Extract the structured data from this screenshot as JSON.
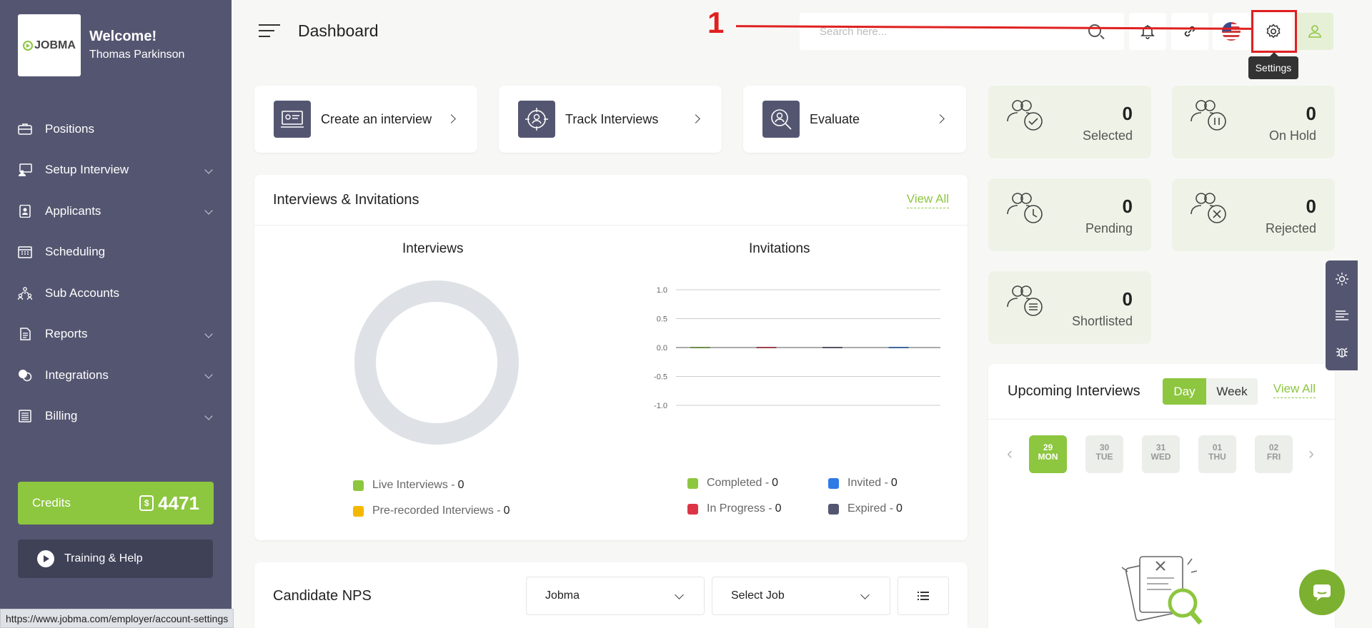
{
  "sidebar": {
    "logo_text": "JOBMA",
    "welcome": "Welcome!",
    "username": "Thomas Parkinson",
    "items": [
      {
        "label": "Positions"
      },
      {
        "label": "Setup Interview"
      },
      {
        "label": "Applicants"
      },
      {
        "label": "Scheduling"
      },
      {
        "label": "Sub Accounts"
      },
      {
        "label": "Reports"
      },
      {
        "label": "Integrations"
      },
      {
        "label": "Billing"
      }
    ],
    "credits_label": "Credits",
    "credits_value": "4471",
    "training_label": "Training & Help"
  },
  "header": {
    "title": "Dashboard",
    "search_placeholder": "Search here...",
    "tooltip": "Settings"
  },
  "annotation": {
    "number": "1"
  },
  "quick_actions": [
    {
      "label": "Create an interview"
    },
    {
      "label": "Track Interviews"
    },
    {
      "label": "Evaluate"
    }
  ],
  "stats": [
    {
      "value": "0",
      "label": "Selected"
    },
    {
      "value": "0",
      "label": "On Hold"
    },
    {
      "value": "0",
      "label": "Pending"
    },
    {
      "value": "0",
      "label": "Rejected"
    },
    {
      "value": "0",
      "label": "Shortlisted"
    }
  ],
  "interviews_panel": {
    "title": "Interviews & Invitations",
    "view_all": "View All",
    "interviews_title": "Interviews",
    "invitations_title": "Invitations",
    "interview_legend": [
      {
        "label": "Live Interviews - ",
        "value": "0",
        "color": "#8dc63f"
      },
      {
        "label": "Pre-recorded Interviews - ",
        "value": "0",
        "color": "#f5b800"
      }
    ],
    "invitation_legend": [
      {
        "label": "Completed - ",
        "value": "0",
        "color": "#8dc63f"
      },
      {
        "label": "Invited - ",
        "value": "0",
        "color": "#2f7ae5"
      },
      {
        "label": "In Progress - ",
        "value": "0",
        "color": "#dc3545"
      },
      {
        "label": "Expired - ",
        "value": "0",
        "color": "#545671"
      }
    ]
  },
  "chart_data": [
    {
      "type": "pie",
      "title": "Interviews",
      "categories": [
        "Live Interviews",
        "Pre-recorded Interviews"
      ],
      "values": [
        0,
        0
      ]
    },
    {
      "type": "line",
      "title": "Invitations",
      "ylim": [
        -1.0,
        1.0
      ],
      "yticks": [
        "1.0",
        "0.5",
        "0.0",
        "-0.5",
        "-1.0"
      ],
      "series": [
        {
          "name": "Completed",
          "values": [
            0
          ]
        },
        {
          "name": "Invited",
          "values": [
            0
          ]
        },
        {
          "name": "In Progress",
          "values": [
            0
          ]
        },
        {
          "name": "Expired",
          "values": [
            0
          ]
        }
      ]
    }
  ],
  "upcoming": {
    "title": "Upcoming Interviews",
    "day_label": "Day",
    "week_label": "Week",
    "view_all": "View All",
    "prev": "‹",
    "next": "›",
    "dates": [
      {
        "day": "29",
        "dow": "MON"
      },
      {
        "day": "30",
        "dow": "TUE"
      },
      {
        "day": "31",
        "dow": "WED"
      },
      {
        "day": "01",
        "dow": "THU"
      },
      {
        "day": "02",
        "dow": "FRI"
      }
    ]
  },
  "nps": {
    "title": "Candidate NPS",
    "select_company": "Jobma",
    "select_job": "Select Job"
  },
  "status_url": "https://www.jobma.com/employer/account-settings",
  "colors": {
    "accent": "#8dc63f",
    "sidebar": "#545671",
    "annotation": "#e02020"
  }
}
